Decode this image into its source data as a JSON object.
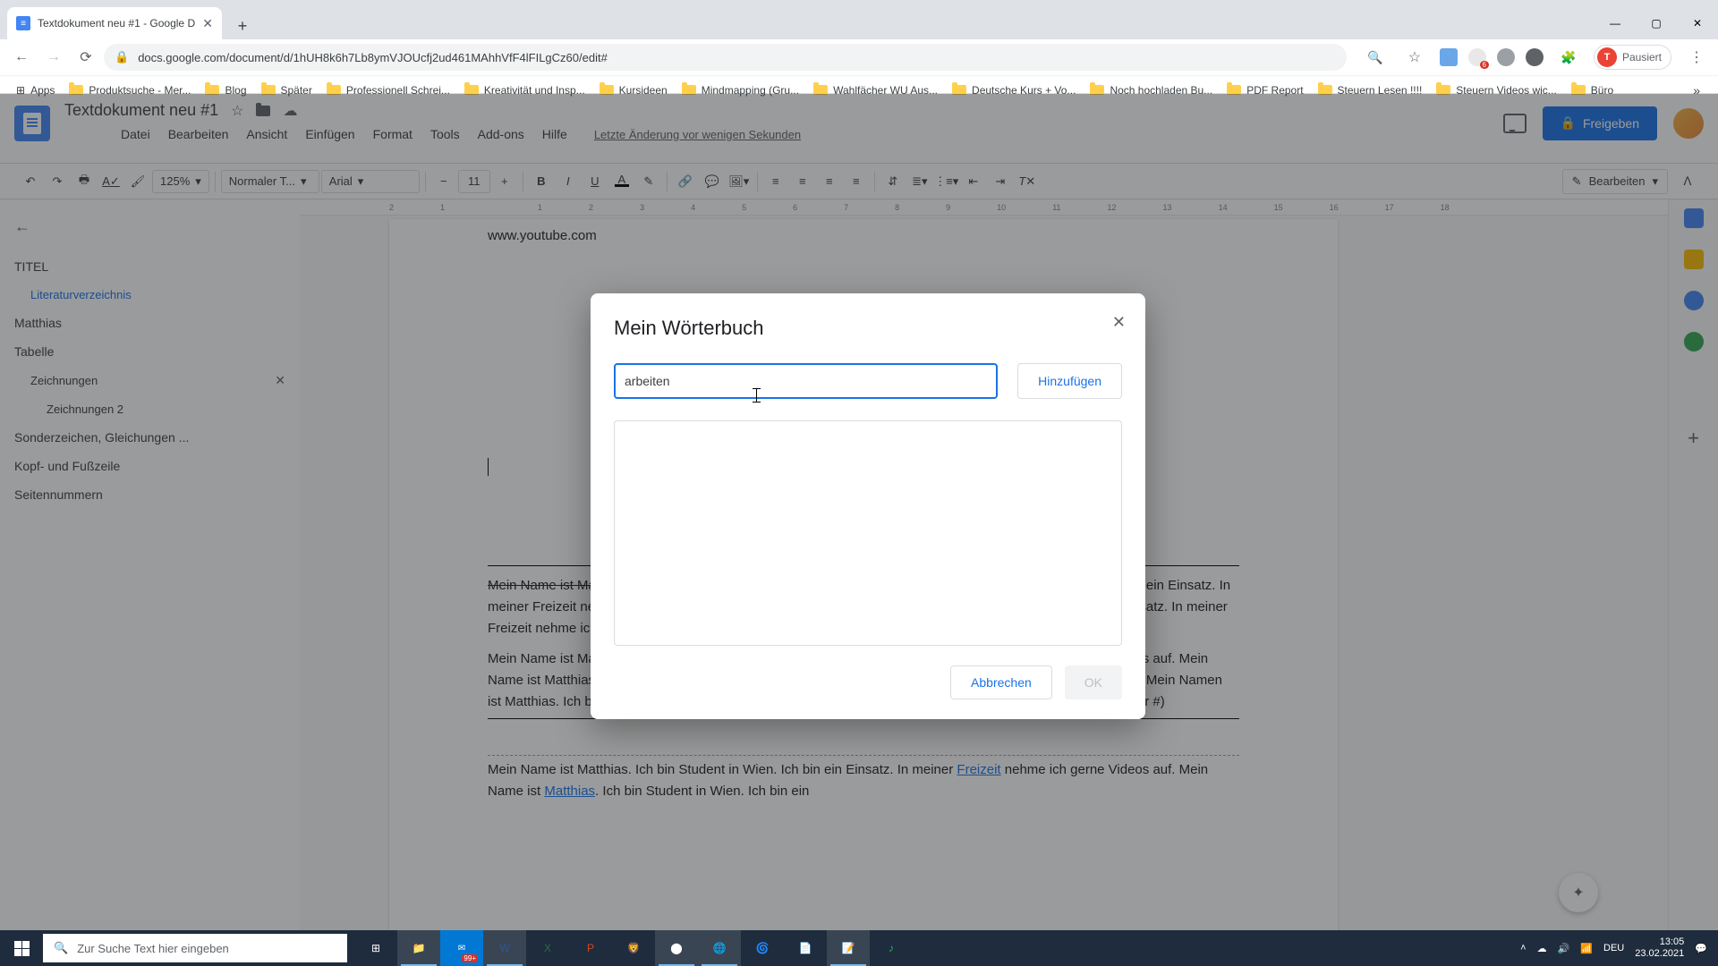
{
  "browser": {
    "tab_title": "Textdokument neu #1 - Google D",
    "url": "docs.google.com/document/d/1hUH8k6h7Lb8ymVJOUcfj2ud461MAhhVfF4lFILgCz60/edit#",
    "profile_status": "Pausiert",
    "profile_initial": "T",
    "bookmarks": [
      "Apps",
      "Produktsuche - Mer...",
      "Blog",
      "Später",
      "Professionell Schrei...",
      "Kreativität und Insp...",
      "Kursideen",
      "Mindmapping (Gru...",
      "Wahlfächer WU Aus...",
      "Deutsche Kurs + Vo...",
      "Noch hochladen Bu...",
      "PDF Report",
      "Steuern Lesen !!!!",
      "Steuern Videos wic...",
      "Büro"
    ]
  },
  "docs": {
    "title": "Textdokument neu #1",
    "menus": [
      "Datei",
      "Bearbeiten",
      "Ansicht",
      "Einfügen",
      "Format",
      "Tools",
      "Add-ons",
      "Hilfe"
    ],
    "last_edit": "Letzte Änderung vor wenigen Sekunden",
    "share": "Freigeben",
    "edit_mode": "Bearbeiten",
    "zoom": "125%",
    "style_select": "Normaler T...",
    "font": "Arial",
    "font_size": "11"
  },
  "outline": {
    "items": [
      {
        "label": "TITEL",
        "cls": ""
      },
      {
        "label": "Literaturverzeichnis",
        "cls": "sub1 sel"
      },
      {
        "label": "Matthias",
        "cls": ""
      },
      {
        "label": "Tabelle",
        "cls": ""
      },
      {
        "label": "Zeichnungen",
        "cls": "sub1",
        "rm": true
      },
      {
        "label": "Zeichnungen 2",
        "cls": "sub2"
      },
      {
        "label": "Sonderzeichen, Gleichungen ...",
        "cls": ""
      },
      {
        "label": "Kopf- und Fußzeile",
        "cls": ""
      },
      {
        "label": "Seitennummern",
        "cls": ""
      }
    ]
  },
  "document": {
    "first_line": "www.youtube.com",
    "para1_strike": "Mein Name ist Matthias",
    "para1_rest": "nehme ich gerne Videos auf. Mein Name ist Matthias. Ich bin Student in Wien. Ich bin ein Einsatz. In meiner Freizeit nehme ich gerne Videos auf. Mein Namen ist Matthias. Ich bin Student in Wien. Ich bin ein Einsatz. In meiner Freizeit nehme ich gerne Videos auf. Fehler machen ist menschlich.",
    "para2": "Mein Name ist Matthias. Ich bin Student in Wien. Ich bin ein Einsatz. In meiner Freizeit nehme ich gerne Videos auf. Mein Name ist Matthias. Ich bin Student in Wien. Ich bin ein Einsatz. In meiner Freizeit nehme ich gerne Videos auf. Mein Namen ist Matthias. Ich bin Student in Wien. Ich bin ein Einsatz. In meiner Freizeit nehme ich gerne Videos auf (Becker #)",
    "para3_pre": "Mein Name ist Matthias. Ich bin Student in Wien. Ich bin ein Einsatz. In meiner ",
    "para3_link1": "Freizeit",
    "para3_mid": " nehme ich gerne Videos auf. Mein Name ist ",
    "para3_link2": "Matthias",
    "para3_post": ". Ich bin Student in Wien. Ich bin ein"
  },
  "dialog": {
    "title": "Mein Wörterbuch",
    "input_value": "arbeiten",
    "add": "Hinzufügen",
    "cancel": "Abbrechen",
    "ok": "OK"
  },
  "taskbar": {
    "search_placeholder": "Zur Suche Text hier eingeben",
    "lang": "DEU",
    "time": "13:05",
    "date": "23.02.2021"
  }
}
